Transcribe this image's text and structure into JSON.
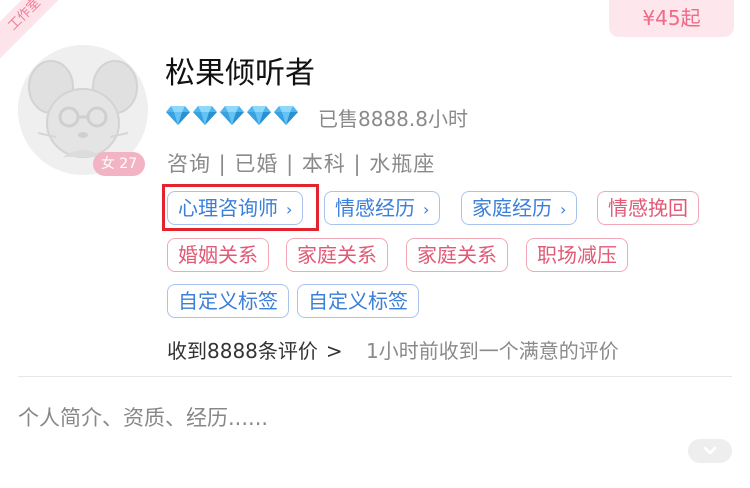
{
  "ribbon": {
    "label": "工作室"
  },
  "price": {
    "label": "¥45起"
  },
  "profile": {
    "name": "松果倾听者",
    "gender_age": "女 27",
    "diamond_count": 5,
    "sold": "已售8888.8小时",
    "info": "咨询 | 已婚 | 本科 | 水瓶座"
  },
  "tags": {
    "row1": [
      {
        "label": "心理咨询师",
        "chev": "›"
      },
      {
        "label": "情感经历",
        "chev": "›"
      },
      {
        "label": "家庭经历",
        "chev": "›"
      },
      {
        "label": "情感挽回"
      }
    ],
    "row2": [
      {
        "label": "婚姻关系"
      },
      {
        "label": "家庭关系"
      },
      {
        "label": "家庭关系"
      },
      {
        "label": "职场减压"
      }
    ],
    "row3": [
      {
        "label": "自定义标签"
      },
      {
        "label": "自定义标签"
      }
    ]
  },
  "reviews": {
    "count_label": "收到8888条评价",
    "chev": ">",
    "latest": "1小时前收到一个满意的评价"
  },
  "intro": {
    "text": "个人简介、资质、经历......"
  },
  "icons": {
    "diamond": "diamond-icon",
    "avatar": "mouse-avatar",
    "expand": "chevron-down-icon"
  },
  "colors": {
    "blue_tag": "#3c7fd9",
    "pink_tag": "#e05a76",
    "highlight": "#e3232d",
    "price": "#ef6a87"
  }
}
